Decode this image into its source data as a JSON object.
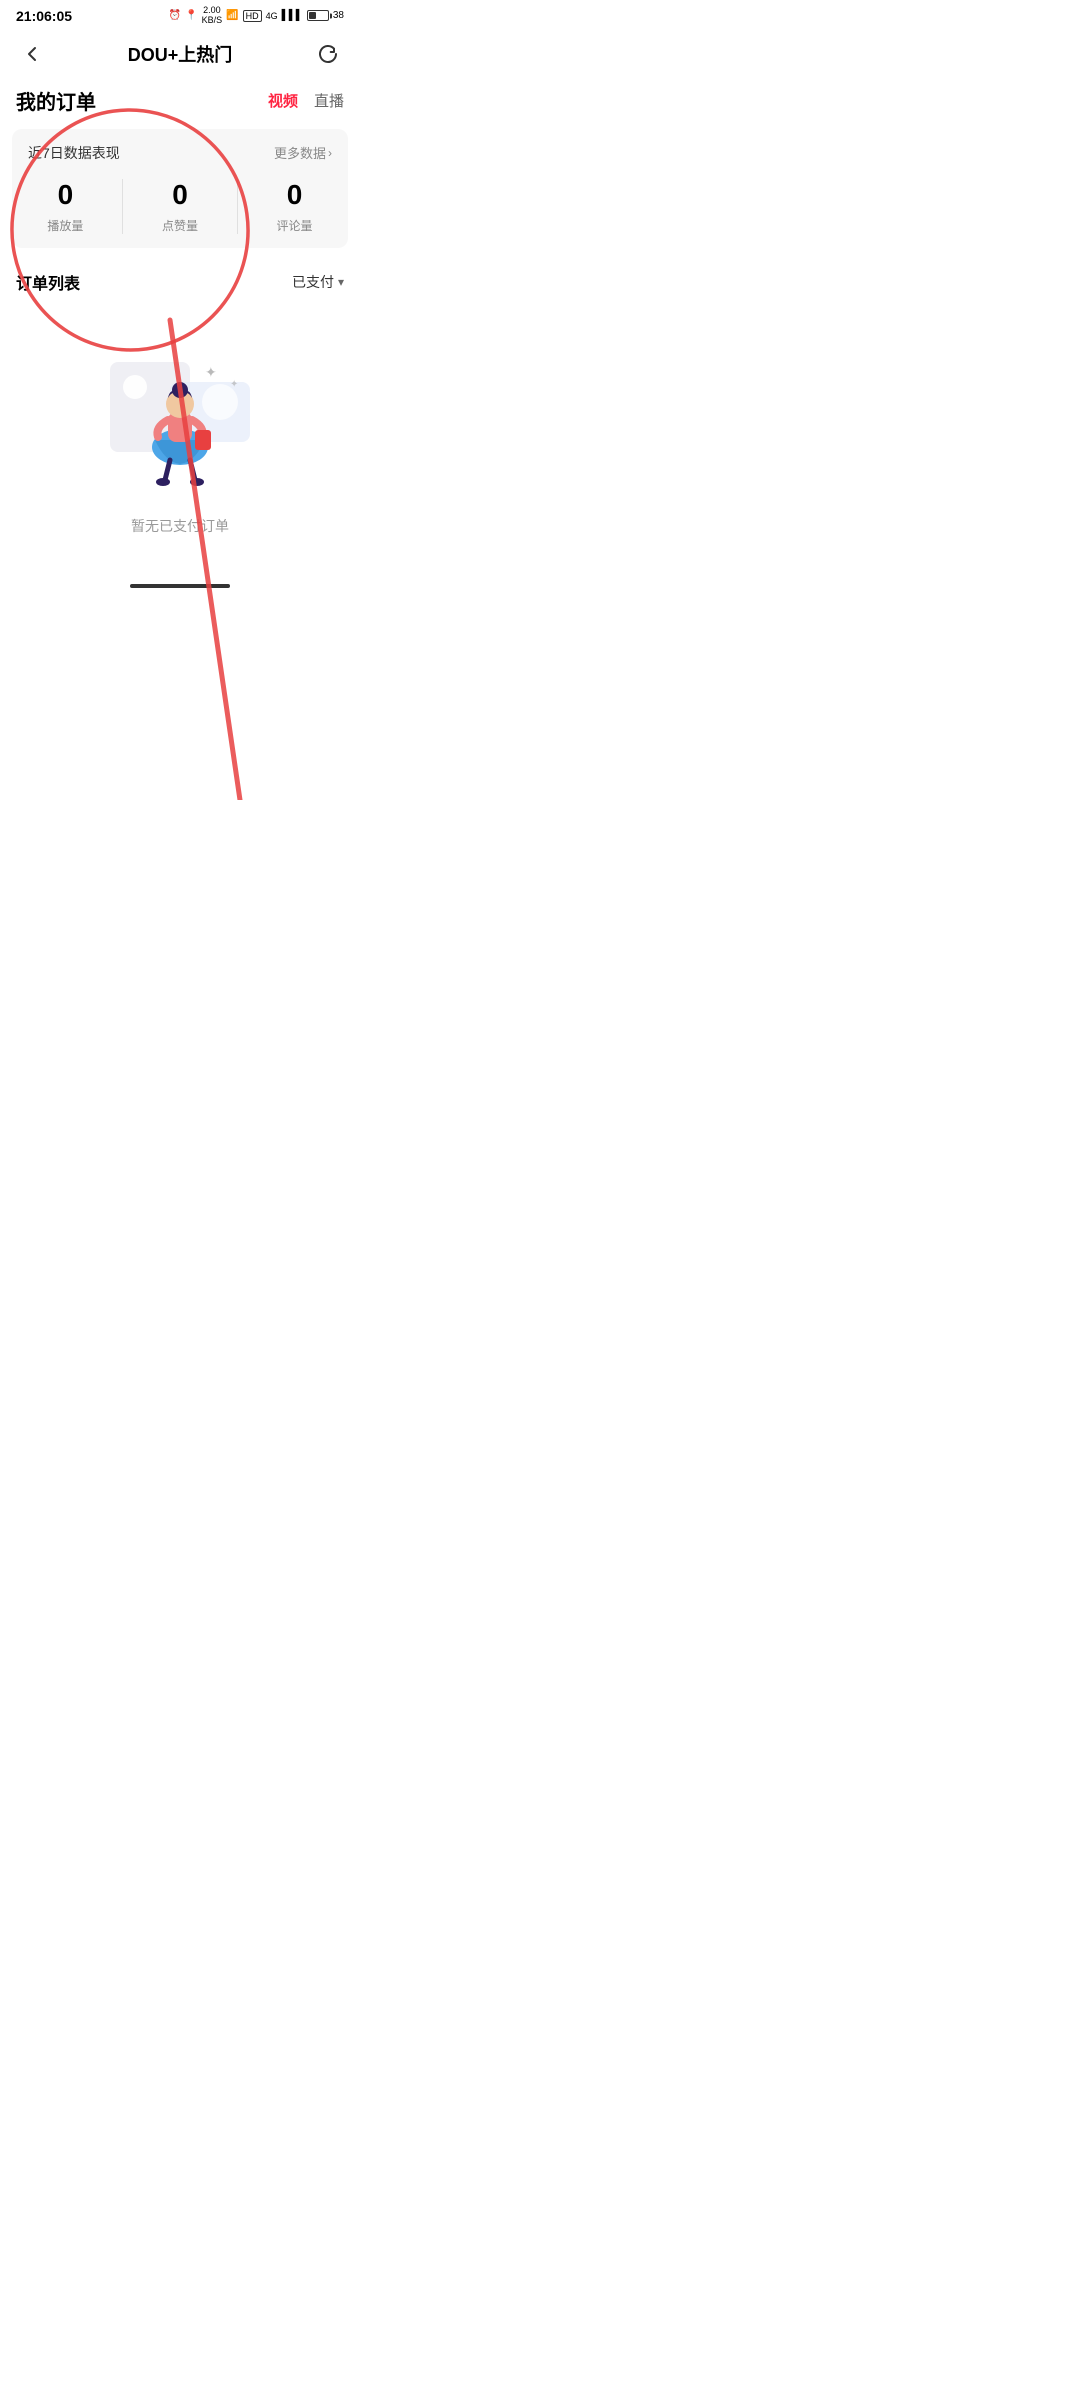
{
  "statusBar": {
    "time": "21:06:05",
    "batteryPercent": "38"
  },
  "navBar": {
    "title": "DOU+上热门",
    "backLabel": "‹",
    "refreshLabel": "↺"
  },
  "pageHeader": {
    "title": "我的订单",
    "tabs": [
      {
        "label": "视频",
        "active": true
      },
      {
        "label": "直播",
        "active": false
      }
    ]
  },
  "dataCard": {
    "title": "近7日数据表现",
    "moreLabel": "更多数据",
    "metrics": [
      {
        "value": "0",
        "label": "播放量"
      },
      {
        "value": "0",
        "label": "点赞量"
      },
      {
        "value": "0",
        "label": "评论量"
      }
    ]
  },
  "orderSection": {
    "title": "订单列表",
    "filterLabel": "已支付",
    "filterIcon": "▾"
  },
  "emptyState": {
    "text": "暂无已支付订单"
  },
  "colors": {
    "accent": "#ff2442",
    "annotationRed": "#e84040"
  }
}
